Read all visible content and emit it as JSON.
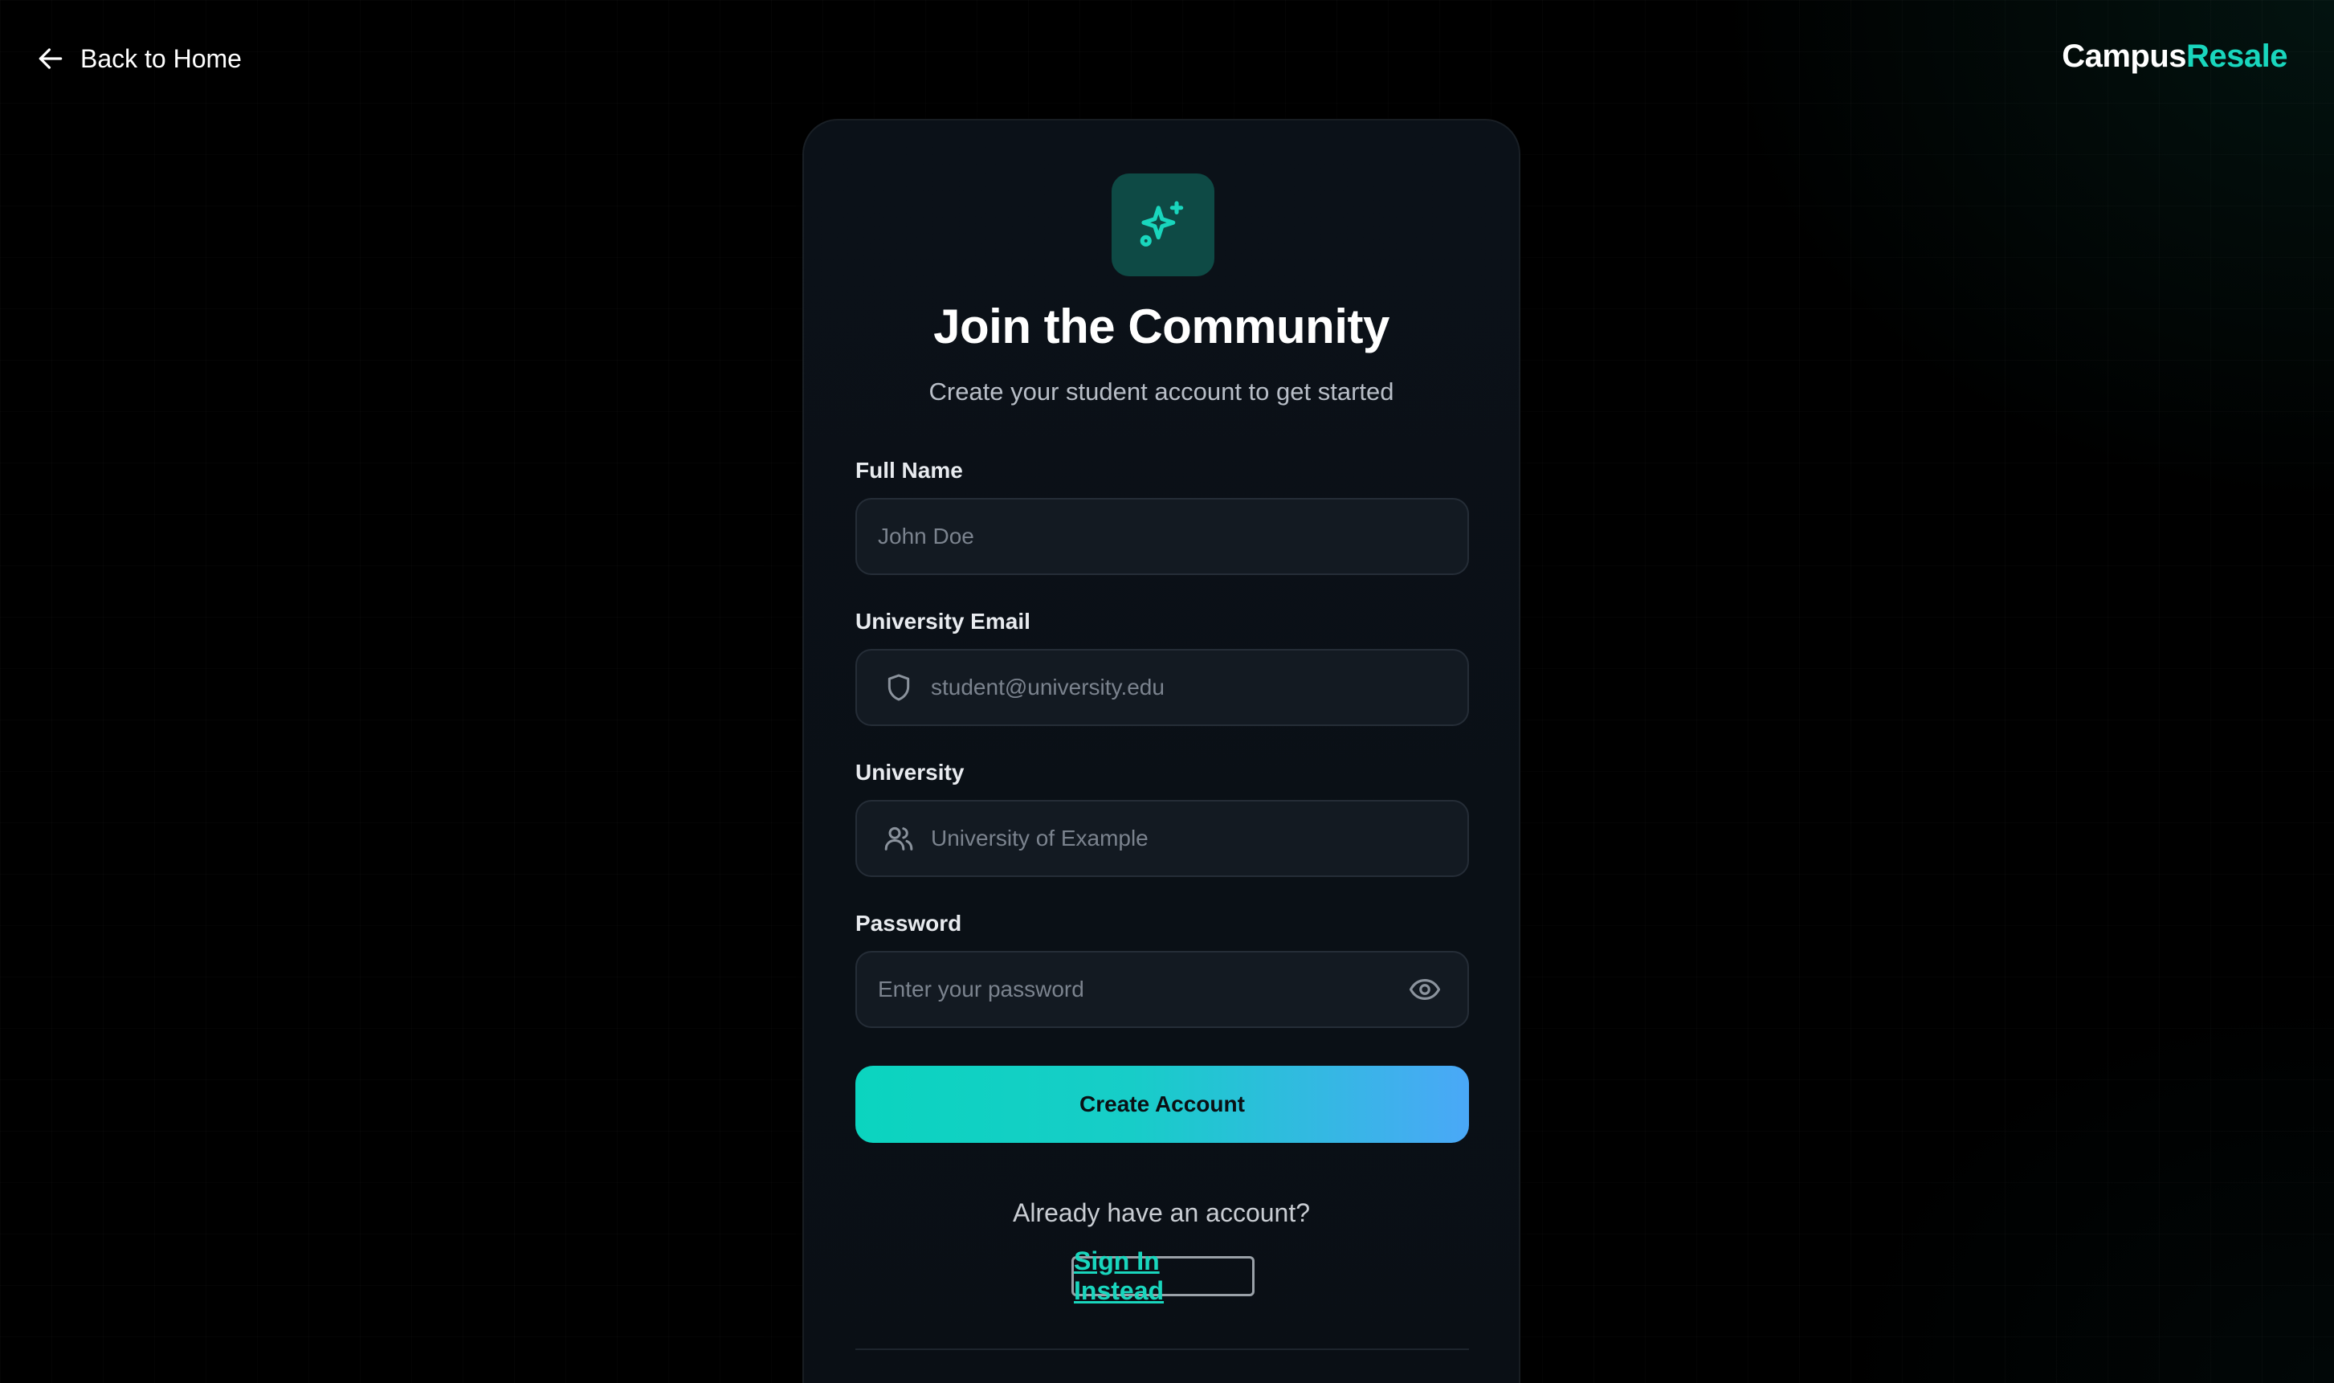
{
  "nav": {
    "back_label": "Back to Home",
    "brand_part1": "Campus",
    "brand_part2": "Resale"
  },
  "card": {
    "title": "Join the Community",
    "subtitle": "Create your student account to get started",
    "logo_icon": "sparkles-icon"
  },
  "form": {
    "full_name": {
      "label": "Full Name",
      "placeholder": "John Doe",
      "value": ""
    },
    "email": {
      "label": "University Email",
      "placeholder": "student@university.edu",
      "value": "",
      "icon": "shield-icon"
    },
    "university": {
      "label": "University",
      "placeholder": "University of Example",
      "value": "",
      "icon": "users-icon"
    },
    "password": {
      "label": "Password",
      "placeholder": "Enter your password",
      "value": "",
      "icon": "eye-icon"
    },
    "submit_label": "Create Account"
  },
  "footer": {
    "prompt": "Already have an account?",
    "signin_label": "Sign In Instead"
  },
  "colors": {
    "accent": "#19d6bd",
    "gradient_start": "#0bd4bf",
    "gradient_end": "#4aa8f7",
    "background": "#000000",
    "card": "#0b1118",
    "input": "#131a22"
  }
}
